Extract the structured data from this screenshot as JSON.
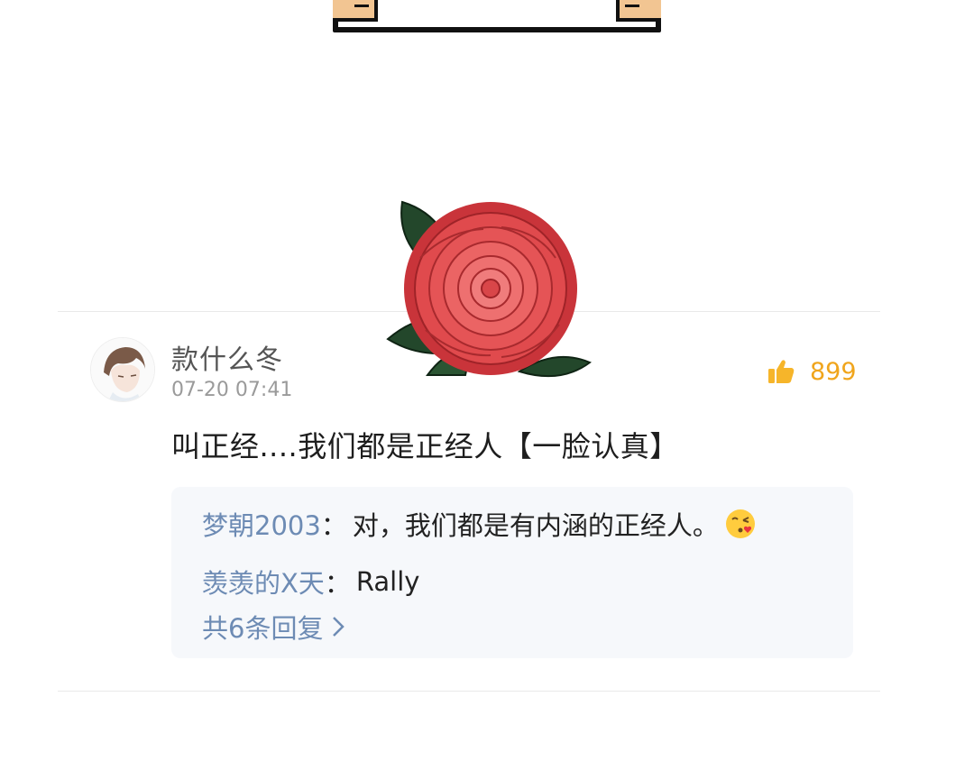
{
  "comment": {
    "author": "款什么冬",
    "timestamp": "07-20 07:41",
    "likes": "899",
    "text": "叫正经....我们都是正经人【一脸认真】"
  },
  "replies": [
    {
      "name": "梦朝2003",
      "colon": "：",
      "text": "对，我们都是有内涵的正经人。",
      "emoji": "kissing-heart-emoji"
    },
    {
      "name": "羡羡的X天",
      "colon": "：",
      "text": "Rally"
    }
  ],
  "more_replies_label": "共6条回复",
  "colors": {
    "accent": "#f0a51c",
    "link": "#6d8bb4",
    "reply_bg": "#f6f8fb"
  },
  "icons": [
    "thumbs-up-icon",
    "chevron-right-icon",
    "rose-sticker"
  ]
}
